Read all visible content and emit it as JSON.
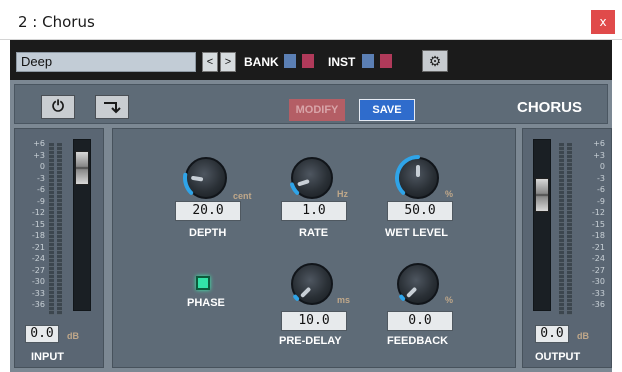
{
  "window": {
    "title": "2 : Chorus",
    "close_label": "x"
  },
  "toolbar": {
    "preset_value": "Deep",
    "prev_label": "<",
    "next_label": ">",
    "bank_label": "BANK",
    "inst_label": "INST",
    "square_colors": [
      "#5b7fb4",
      "#b03a5a",
      "#5b7fb4",
      "#b03a5a"
    ],
    "settings_icon": "gear-icon"
  },
  "plugin": {
    "power_icon": "power-icon",
    "bypass_icon": "route-arrow-icon",
    "modify_label": "MODIFY",
    "save_label": "SAVE",
    "name": "CHORUS",
    "scale_ticks": [
      "+6",
      "+3",
      "0",
      "-3",
      "-6",
      "-9",
      "-12",
      "-15",
      "-18",
      "-21",
      "-24",
      "-27",
      "-30",
      "-33",
      "-36"
    ]
  },
  "input": {
    "label": "INPUT",
    "value": "0.0",
    "unit": "dB",
    "fader_level": 0.92
  },
  "output": {
    "label": "OUTPUT",
    "value": "0.0",
    "unit": "dB",
    "fader_level": 0.72
  },
  "controls": {
    "depth": {
      "label": "DEPTH",
      "value": "20.0",
      "unit": "cent",
      "level": 0.2,
      "accent": "#2fa4e8"
    },
    "rate": {
      "label": "RATE",
      "value": "1.0",
      "unit": "Hz",
      "level": 0.1,
      "accent": "#2fa4e8"
    },
    "wet_level": {
      "label": "WET LEVEL",
      "value": "50.0",
      "unit": "%",
      "level": 0.5,
      "accent": "#2fa4e8"
    },
    "pre_delay": {
      "label": "PRE-DELAY",
      "value": "10.0",
      "unit": "ms",
      "level": 0.0,
      "accent": "#2fa4e8"
    },
    "feedback": {
      "label": "FEEDBACK",
      "value": "0.0",
      "unit": "%",
      "level": 0.0,
      "accent": "#2fa4e8"
    },
    "phase": {
      "label": "PHASE",
      "state": "on"
    }
  }
}
